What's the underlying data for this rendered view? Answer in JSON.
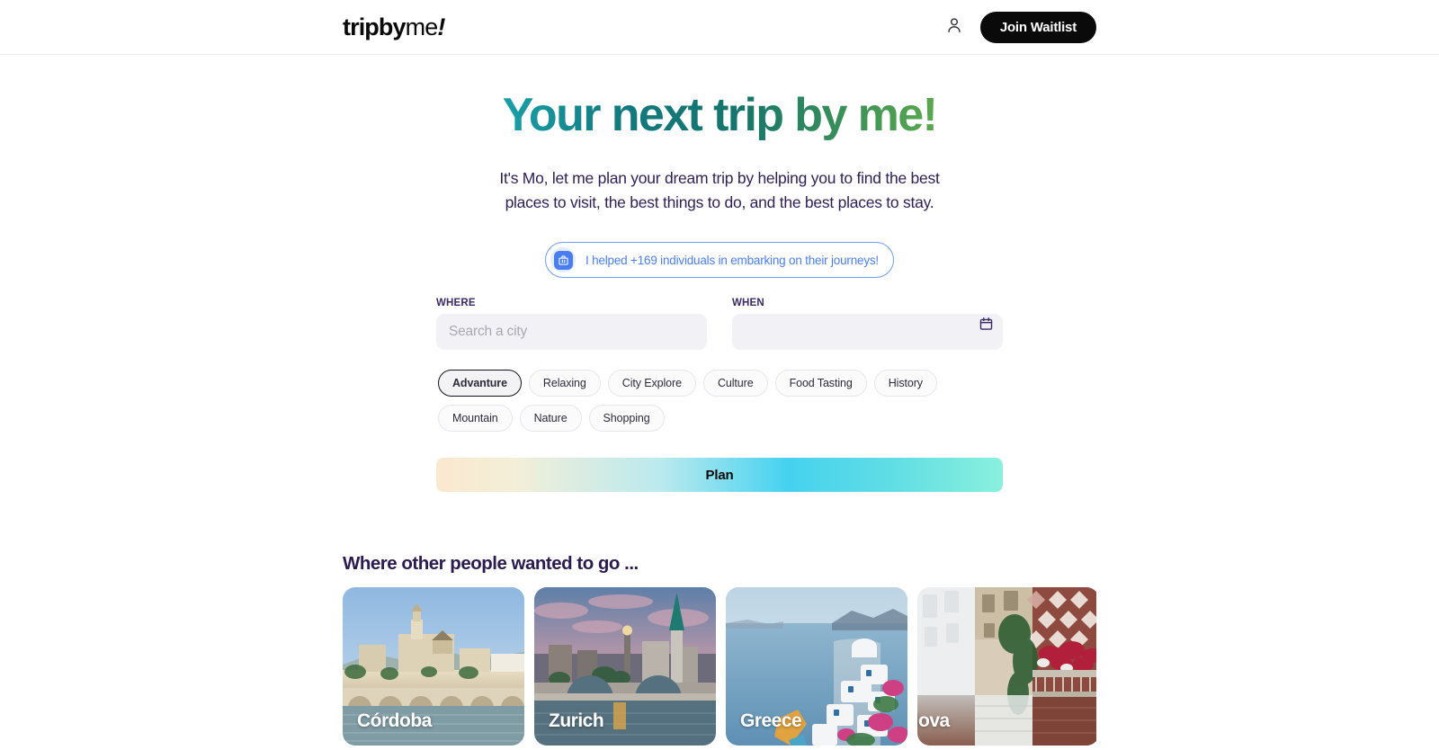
{
  "header": {
    "logo": {
      "bold": "tripby",
      "light": "me",
      "bang": "!"
    },
    "user_icon": "user-icon",
    "waitlist_label": "Join Waitlist"
  },
  "hero": {
    "title": "Your next trip by me!",
    "subtitle": "It's Mo, let me plan your dream trip by helping you to find the best places to visit, the best things to do, and the best places to stay.",
    "badge": {
      "icon": "suitcase-icon",
      "text": "I helped +169 individuals in embarking on their journeys!",
      "color": "#4a7ef0"
    }
  },
  "search": {
    "where_label": "WHERE",
    "where_value": "",
    "where_placeholder": "Search a city",
    "when_label": "WHEN",
    "when_value": "",
    "when_placeholder": "",
    "calendar_icon": "calendar-icon",
    "plan_label": "Plan",
    "tags": [
      {
        "label": "Advanture",
        "selected": true
      },
      {
        "label": "Relaxing",
        "selected": false
      },
      {
        "label": "City Explore",
        "selected": false
      },
      {
        "label": "Culture",
        "selected": false
      },
      {
        "label": "Food Tasting",
        "selected": false
      },
      {
        "label": "History",
        "selected": false
      },
      {
        "label": "Mountain",
        "selected": false
      },
      {
        "label": "Nature",
        "selected": false
      },
      {
        "label": "Shopping",
        "selected": false
      }
    ]
  },
  "destinations": {
    "heading": "Where other people wanted to go ...",
    "cards": [
      {
        "label": "Córdoba"
      },
      {
        "label": "Zurich"
      },
      {
        "label": "Greece"
      },
      {
        "label": "Padova"
      }
    ]
  },
  "theme": {
    "accent_blue": "#4a7ef0",
    "text_navy": "#2e1f54",
    "black": "#0a0a0a"
  }
}
